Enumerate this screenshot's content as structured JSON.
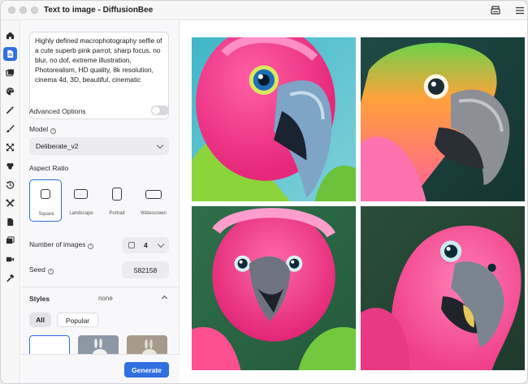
{
  "window": {
    "title": "Text to image - DiffusionBee"
  },
  "prompt": {
    "text": "Highly defined macrophotography selfie of a cute superb pink parrot, sharp focus, no blur, no dof, extreme illustration, Photorealism, HD quality, 8k resolution, cinema 4d, 3D, beautiful, cinematic"
  },
  "advanced": {
    "label": "Advanced Options",
    "enabled": false
  },
  "model": {
    "label": "Model",
    "value": "Deliberate_v2"
  },
  "aspect": {
    "label": "Aspect Ratio",
    "options": [
      "Square",
      "Landscape",
      "Portrait",
      "Widescreen"
    ],
    "selected": "Square"
  },
  "num_images": {
    "label": "Number of images",
    "value": "4"
  },
  "seed": {
    "label": "Seed",
    "value": "582158"
  },
  "styles": {
    "label": "Styles",
    "current": "none",
    "tabs": [
      "All",
      "Popular"
    ]
  },
  "actions": {
    "generate": "Generate"
  },
  "colors": {
    "accent": "#2f6fe0",
    "sidebar_bg": "#f7f7f8"
  },
  "sidebar_icons": [
    "home-icon",
    "text-to-image-icon",
    "image-to-image-icon",
    "palette-icon",
    "magic-wand-icon",
    "brush-icon",
    "expand-icon",
    "layers-icon",
    "history-icon",
    "tools-icon",
    "document-icon",
    "gallery-icon",
    "video-icon",
    "hammer-icon"
  ]
}
